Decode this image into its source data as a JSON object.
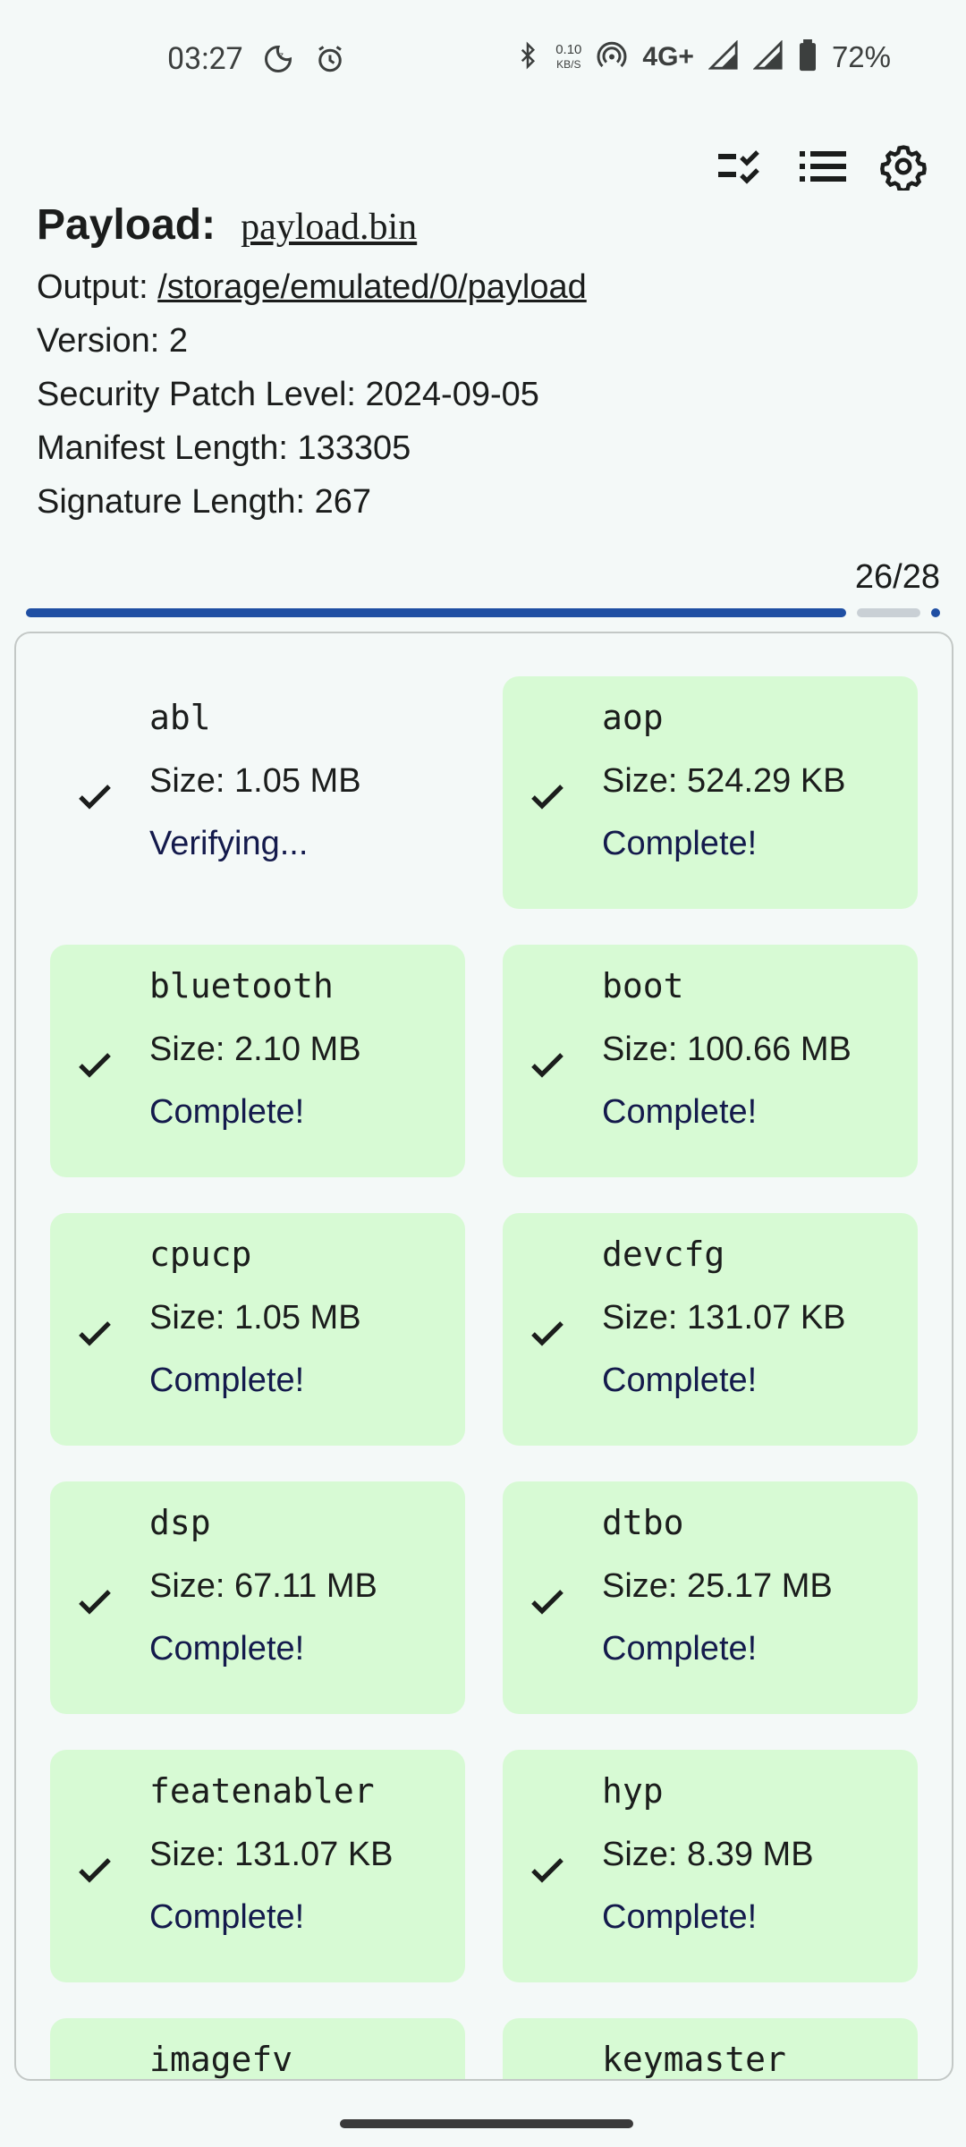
{
  "status_bar": {
    "time": "03:27",
    "net_speed_value": "0.10",
    "net_speed_unit": "KB/S",
    "network": "4G+",
    "battery": "72%",
    "icons": [
      "moon-icon",
      "alarm-icon",
      "bluetooth-icon",
      "hotspot-icon",
      "signal-icon",
      "signal-icon",
      "battery-icon"
    ]
  },
  "toolbar": {
    "icons": [
      "checklist-icon",
      "list-icon",
      "settings-icon"
    ]
  },
  "header": {
    "payload_label": "Payload:",
    "payload_file": "payload.bin",
    "output_label": "Output:",
    "output_path": "/storage/emulated/0/payload",
    "version": "Version: 2",
    "security_patch": "Security Patch Level: 2024-09-05",
    "manifest_length": "Manifest Length: 133305",
    "signature_length": "Signature Length: 267"
  },
  "progress": {
    "label": "26/28",
    "done": 26,
    "total": 28
  },
  "partitions": [
    {
      "name": "abl",
      "size": "Size: 1.05 MB",
      "status": "Verifying...",
      "complete": false
    },
    {
      "name": "aop",
      "size": "Size: 524.29 KB",
      "status": "Complete!",
      "complete": true
    },
    {
      "name": "bluetooth",
      "size": "Size: 2.10 MB",
      "status": "Complete!",
      "complete": true
    },
    {
      "name": "boot",
      "size": "Size: 100.66 MB",
      "status": "Complete!",
      "complete": true
    },
    {
      "name": "cpucp",
      "size": "Size: 1.05 MB",
      "status": "Complete!",
      "complete": true
    },
    {
      "name": "devcfg",
      "size": "Size: 131.07 KB",
      "status": "Complete!",
      "complete": true
    },
    {
      "name": "dsp",
      "size": "Size: 67.11 MB",
      "status": "Complete!",
      "complete": true
    },
    {
      "name": "dtbo",
      "size": "Size: 25.17 MB",
      "status": "Complete!",
      "complete": true
    },
    {
      "name": "featenabler",
      "size": "Size: 131.07 KB",
      "status": "Complete!",
      "complete": true
    },
    {
      "name": "hyp",
      "size": "Size: 8.39 MB",
      "status": "Complete!",
      "complete": true
    },
    {
      "name": "imagefv",
      "size": "",
      "status": "",
      "complete": true
    },
    {
      "name": "keymaster",
      "size": "",
      "status": "",
      "complete": true
    }
  ],
  "colors": {
    "background": "#f4f9f8",
    "tile_complete": "#d7fad4",
    "progress": "#1f4fa3",
    "status_text": "#141a4c"
  }
}
